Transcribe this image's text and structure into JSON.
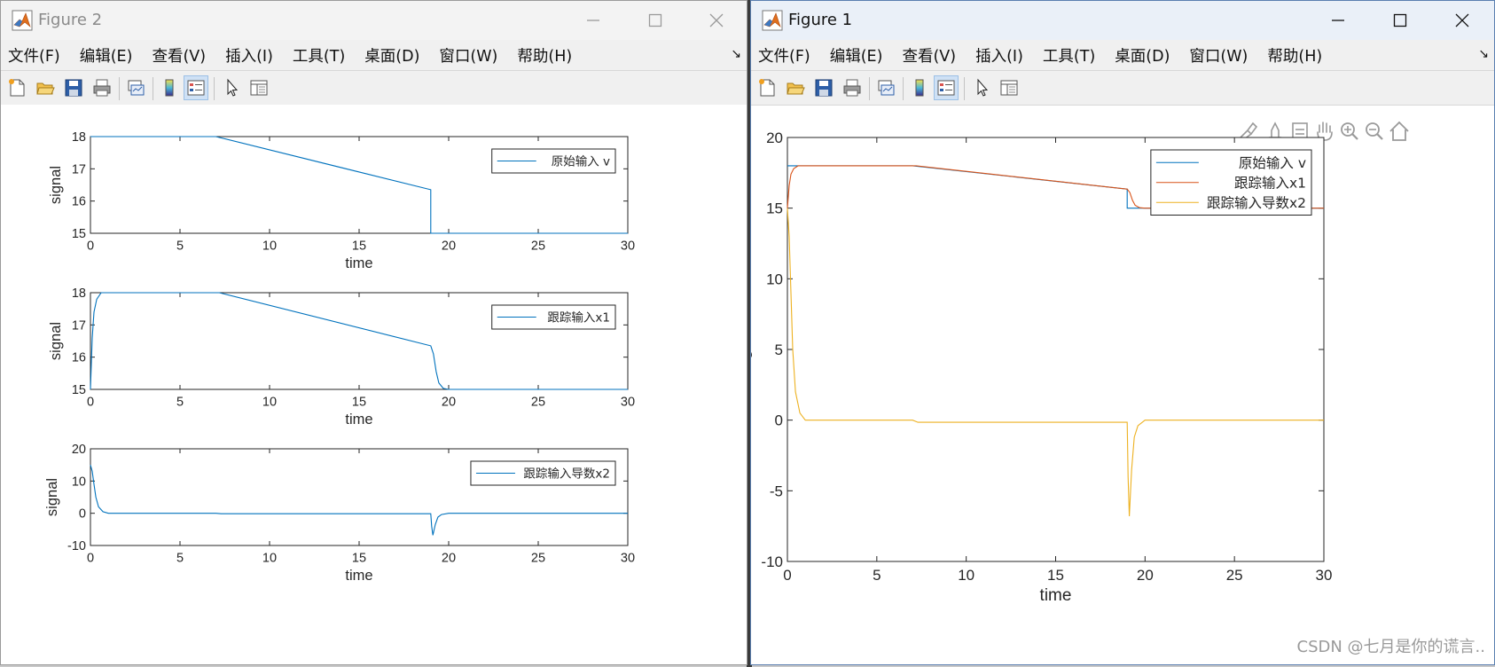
{
  "windows": {
    "fig2": {
      "title": "Figure 2",
      "menu": [
        "文件(F)",
        "编辑(E)",
        "查看(V)",
        "插入(I)",
        "工具(T)",
        "桌面(D)",
        "窗口(W)",
        "帮助(H)"
      ],
      "menu_arrow": "↘"
    },
    "fig1": {
      "title": "Figure 1",
      "menu": [
        "文件(F)",
        "编辑(E)",
        "查看(V)",
        "插入(I)",
        "工具(T)",
        "桌面(D)",
        "窗口(W)",
        "帮助(H)"
      ],
      "menu_arrow": "↘"
    }
  },
  "toolbar_icons": [
    "new-figure-icon",
    "open-file-icon",
    "save-icon",
    "print-icon",
    "link-plot-icon",
    "colorbar-icon",
    "legend-icon",
    "pointer-icon",
    "property-editor-icon"
  ],
  "axes_toolbar_icons": [
    "brush-icon",
    "data-cursor-icon",
    "pan-hand-icon",
    "zoom-in-icon",
    "zoom-out-icon",
    "home-icon"
  ],
  "colors": {
    "blue": "#0072BD",
    "orange": "#D95319",
    "yellow": "#EDB120"
  },
  "watermark": "CSDN @七月是你的谎言..",
  "chart_data": [
    {
      "figure": "Figure 2",
      "type": "line",
      "xlabel": "time",
      "ylabel": "signal",
      "xlim": [
        0,
        30
      ],
      "ylim": [
        15,
        18
      ],
      "xticks": [
        0,
        5,
        10,
        15,
        20,
        25,
        30
      ],
      "yticks": [
        15,
        16,
        17,
        18
      ],
      "legend_position": "top-right",
      "series": [
        {
          "name": "原始输入 v",
          "color": "#0072BD",
          "points": [
            [
              0,
              18
            ],
            [
              7,
              18
            ],
            [
              19,
              16.35
            ],
            [
              19,
              15
            ],
            [
              30,
              15
            ]
          ]
        }
      ]
    },
    {
      "figure": "Figure 2",
      "type": "line",
      "xlabel": "time",
      "ylabel": "signal",
      "xlim": [
        0,
        30
      ],
      "ylim": [
        15,
        18
      ],
      "xticks": [
        0,
        5,
        10,
        15,
        20,
        25,
        30
      ],
      "yticks": [
        15,
        16,
        17,
        18
      ],
      "legend_position": "top-right",
      "series": [
        {
          "name": "跟踪输入x1",
          "color": "#0072BD",
          "points": [
            [
              0,
              15
            ],
            [
              0.1,
              16.6
            ],
            [
              0.2,
              17.4
            ],
            [
              0.35,
              17.8
            ],
            [
              0.6,
              18
            ],
            [
              7.2,
              18
            ],
            [
              19,
              16.35
            ],
            [
              19.15,
              16.1
            ],
            [
              19.3,
              15.55
            ],
            [
              19.45,
              15.2
            ],
            [
              19.7,
              15.03
            ],
            [
              20,
              15
            ],
            [
              30,
              15
            ]
          ]
        }
      ]
    },
    {
      "figure": "Figure 2",
      "type": "line",
      "xlabel": "time",
      "ylabel": "signal",
      "xlim": [
        0,
        30
      ],
      "ylim": [
        -10,
        20
      ],
      "xticks": [
        0,
        5,
        10,
        15,
        20,
        25,
        30
      ],
      "yticks": [
        -10,
        0,
        10,
        20
      ],
      "legend_position": "top-right",
      "series": [
        {
          "name": "跟踪输入导数x2",
          "color": "#0072BD",
          "points": [
            [
              0,
              15
            ],
            [
              0.1,
              13
            ],
            [
              0.2,
              9
            ],
            [
              0.3,
              5
            ],
            [
              0.45,
              2
            ],
            [
              0.7,
              0.5
            ],
            [
              1,
              0
            ],
            [
              7,
              0
            ],
            [
              7.3,
              -0.15
            ],
            [
              19,
              -0.15
            ],
            [
              19.05,
              -4
            ],
            [
              19.12,
              -6.8
            ],
            [
              19.25,
              -3.5
            ],
            [
              19.4,
              -1.2
            ],
            [
              19.6,
              -0.4
            ],
            [
              20,
              0
            ],
            [
              30,
              0
            ]
          ]
        }
      ]
    },
    {
      "figure": "Figure 1",
      "type": "line",
      "xlabel": "time",
      "ylabel": "signal",
      "xlim": [
        0,
        30
      ],
      "ylim": [
        -10,
        20
      ],
      "xticks": [
        0,
        5,
        10,
        15,
        20,
        25,
        30
      ],
      "yticks": [
        -10,
        -5,
        0,
        5,
        10,
        15,
        20
      ],
      "legend_position": "top-right",
      "series": [
        {
          "name": "原始输入 v",
          "color": "#0072BD",
          "points": [
            [
              0,
              18
            ],
            [
              7,
              18
            ],
            [
              19,
              16.35
            ],
            [
              19,
              15
            ],
            [
              30,
              15
            ]
          ]
        },
        {
          "name": "跟踪输入x1",
          "color": "#D95319",
          "points": [
            [
              0,
              15
            ],
            [
              0.1,
              16.6
            ],
            [
              0.2,
              17.4
            ],
            [
              0.35,
              17.8
            ],
            [
              0.6,
              18
            ],
            [
              7.2,
              18
            ],
            [
              19,
              16.35
            ],
            [
              19.15,
              16.1
            ],
            [
              19.3,
              15.55
            ],
            [
              19.45,
              15.2
            ],
            [
              19.7,
              15.03
            ],
            [
              20,
              15
            ],
            [
              30,
              15
            ]
          ]
        },
        {
          "name": "跟踪输入导数x2",
          "color": "#EDB120",
          "points": [
            [
              0,
              15
            ],
            [
              0.1,
              13
            ],
            [
              0.2,
              9
            ],
            [
              0.3,
              5
            ],
            [
              0.45,
              2
            ],
            [
              0.7,
              0.5
            ],
            [
              1,
              0
            ],
            [
              7,
              0
            ],
            [
              7.3,
              -0.15
            ],
            [
              19,
              -0.15
            ],
            [
              19.05,
              -4
            ],
            [
              19.12,
              -6.8
            ],
            [
              19.25,
              -3.5
            ],
            [
              19.4,
              -1.2
            ],
            [
              19.6,
              -0.4
            ],
            [
              20,
              0
            ],
            [
              30,
              0
            ]
          ]
        }
      ]
    }
  ]
}
